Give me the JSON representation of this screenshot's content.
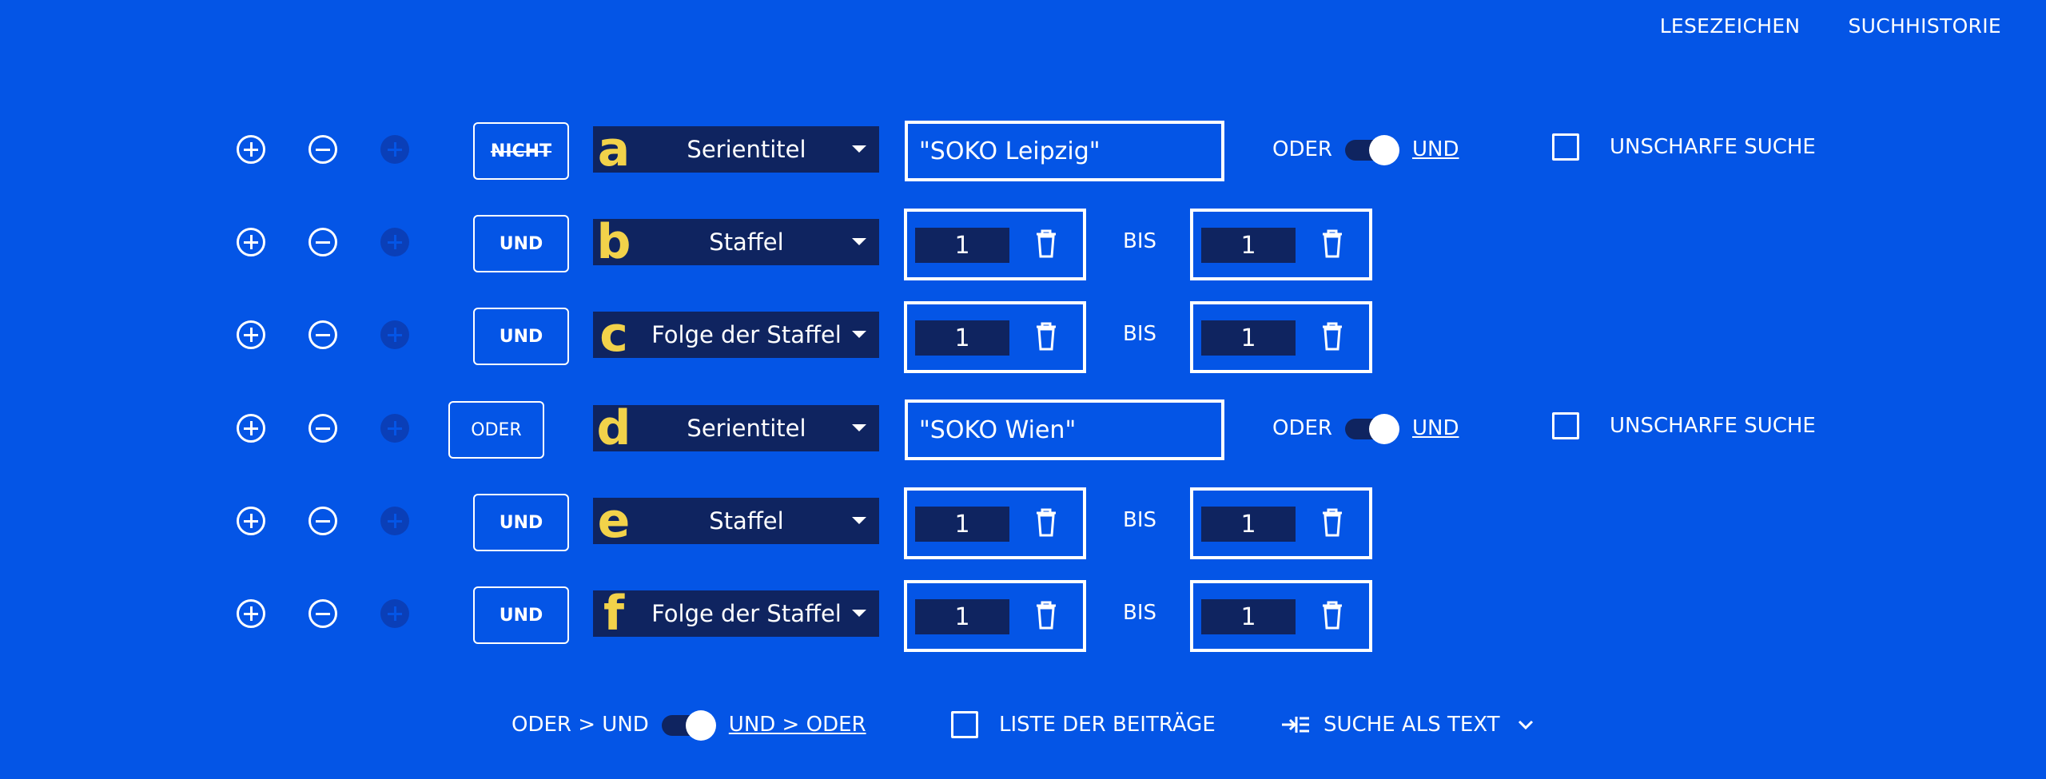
{
  "nav": {
    "bookmarks": "LESEZEICHEN",
    "history": "SUCHHISTORIE"
  },
  "rows": [
    {
      "op": "NICHT",
      "letter": "a",
      "field": "Serientitel",
      "query": "\"SOKO Leipzig\"",
      "toggle_off": "ODER",
      "toggle_on": "UND",
      "checkbox": "UNSCHARFE SUCHE"
    },
    {
      "op": "UND",
      "letter": "b",
      "field": "Staffel",
      "from": "1",
      "between": "BIS",
      "to": "1"
    },
    {
      "op": "UND",
      "letter": "c",
      "field": "Folge der Staffel",
      "from": "1",
      "between": "BIS",
      "to": "1"
    },
    {
      "op": "ODER",
      "letter": "d",
      "field": "Serientitel",
      "query": "\"SOKO Wien\"",
      "toggle_off": "ODER",
      "toggle_on": "UND",
      "checkbox": "UNSCHARFE SUCHE"
    },
    {
      "op": "UND",
      "letter": "e",
      "field": "Staffel",
      "from": "1",
      "between": "BIS",
      "to": "1"
    },
    {
      "op": "UND",
      "letter": "f",
      "field": "Folge der Staffel",
      "from": "1",
      "between": "BIS",
      "to": "1"
    }
  ],
  "footer": {
    "precedence_off": "ODER > UND",
    "precedence_on": "UND > ODER",
    "list_label": "LISTE DER BEITRÄGE",
    "text_search_label": "SUCHE ALS TEXT"
  },
  "colors": {
    "background": "#0455e6",
    "field_bg": "#0f2460",
    "letter": "#f2d24a",
    "foreground": "#ffffff"
  },
  "icons": [
    "plus-circle-icon",
    "minus-circle-icon",
    "add-sub-icon",
    "caret-down-icon",
    "trash-icon",
    "indent-icon",
    "chevron-down-icon"
  ]
}
